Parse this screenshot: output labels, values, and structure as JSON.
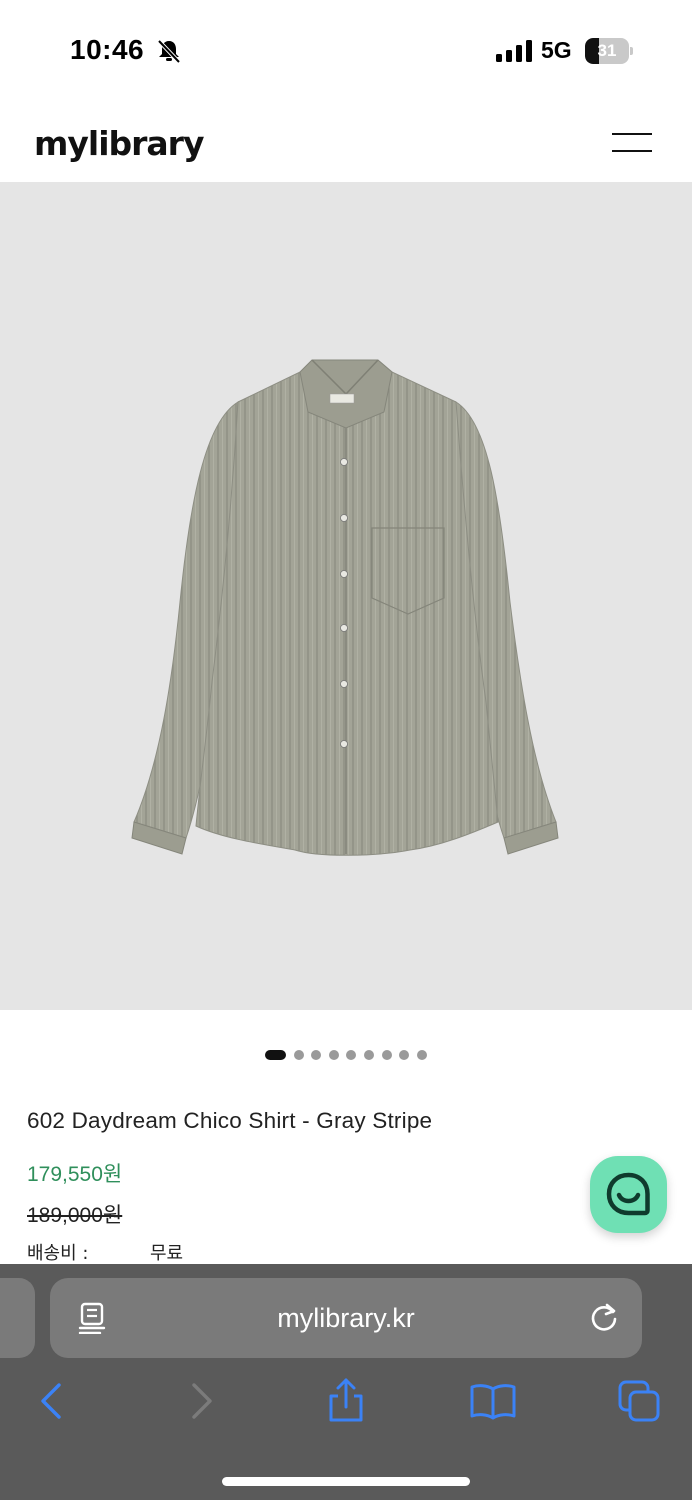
{
  "status_bar": {
    "time": "10:46",
    "network": "5G",
    "battery_level": "31",
    "battery_fraction": 0.31,
    "icons": [
      "bell-slash-icon",
      "cellular-signal-icon",
      "battery-icon"
    ]
  },
  "header": {
    "logo": "mylibrary",
    "menu_icon": "hamburger-menu-icon"
  },
  "gallery": {
    "background_color": "#e5e5e5",
    "image_subject": "gray striped long-sleeve shirt",
    "total_slides": 9,
    "active_slide": 1
  },
  "product": {
    "title": "602 Daydream Chico Shirt - Gray Stripe",
    "sale_price": "179,550원",
    "original_price": "189,000원",
    "shipping_label": "배송비 :",
    "shipping_value": "무료",
    "sale_price_color": "#2f8f5b"
  },
  "chat": {
    "icon": "chat-smile-icon",
    "color": "#6fe0b4"
  },
  "browser": {
    "url": "mylibrary.kr",
    "icons": [
      "reader-page-icon",
      "reload-icon",
      "back-chevron-icon",
      "forward-chevron-icon",
      "share-icon",
      "bookmarks-book-icon",
      "tabs-icon"
    ],
    "accent_color": "#3b82f6"
  }
}
